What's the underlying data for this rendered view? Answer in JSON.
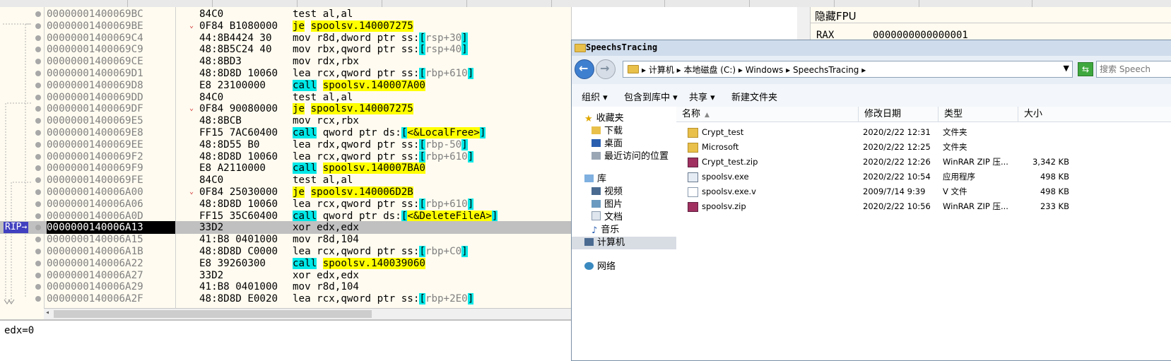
{
  "disassembly": {
    "rows": [
      {
        "addr": "00000001400069BC",
        "bytes": "84C0",
        "instr": [
          {
            "t": "test al,al"
          }
        ]
      },
      {
        "addr": "00000001400069BE",
        "bytes": "0F84 B1080000",
        "arrow": true,
        "instr": [
          {
            "t": "je",
            "h": "y"
          },
          {
            "t": " "
          },
          {
            "t": "spoolsv.140007275",
            "h": "y"
          }
        ]
      },
      {
        "addr": "00000001400069C4",
        "bytes": "44:8B4424 30",
        "instr": [
          {
            "t": "mov r8d,dword ptr ss:"
          },
          {
            "t": "[",
            "h": "c"
          },
          {
            "t": "rsp+30",
            "c": "dim"
          },
          {
            "t": "]",
            "h": "c"
          }
        ]
      },
      {
        "addr": "00000001400069C9",
        "bytes": "48:8B5C24 40",
        "instr": [
          {
            "t": "mov rbx,qword ptr ss:"
          },
          {
            "t": "[",
            "h": "c"
          },
          {
            "t": "rsp+40",
            "c": "dim"
          },
          {
            "t": "]",
            "h": "c"
          }
        ]
      },
      {
        "addr": "00000001400069CE",
        "bytes": "48:8BD3",
        "instr": [
          {
            "t": "mov rdx,rbx"
          }
        ]
      },
      {
        "addr": "00000001400069D1",
        "bytes": "48:8D8D 10060",
        "instr": [
          {
            "t": "lea rcx,qword ptr ss:"
          },
          {
            "t": "[",
            "h": "c"
          },
          {
            "t": "rbp+610",
            "c": "dim"
          },
          {
            "t": "]",
            "h": "c"
          }
        ]
      },
      {
        "addr": "00000001400069D8",
        "bytes": "E8 23100000",
        "instr": [
          {
            "t": "call",
            "h": "c"
          },
          {
            "t": " "
          },
          {
            "t": "spoolsv.140007A00",
            "h": "y"
          }
        ]
      },
      {
        "addr": "00000001400069DD",
        "bytes": "84C0",
        "instr": [
          {
            "t": "test al,al"
          }
        ]
      },
      {
        "addr": "00000001400069DF",
        "bytes": "0F84 90080000",
        "arrow": true,
        "instr": [
          {
            "t": "je",
            "h": "y"
          },
          {
            "t": " "
          },
          {
            "t": "spoolsv.140007275",
            "h": "y"
          }
        ]
      },
      {
        "addr": "00000001400069E5",
        "bytes": "48:8BCB",
        "instr": [
          {
            "t": "mov rcx,rbx"
          }
        ]
      },
      {
        "addr": "00000001400069E8",
        "bytes": "FF15 7AC60400",
        "instr": [
          {
            "t": "call",
            "h": "c"
          },
          {
            "t": " qword ptr ds:"
          },
          {
            "t": "[",
            "h": "c"
          },
          {
            "t": "<&LocalFree>",
            "h": "y"
          },
          {
            "t": "]",
            "h": "c"
          }
        ]
      },
      {
        "addr": "00000001400069EE",
        "bytes": "48:8D55 B0",
        "instr": [
          {
            "t": "lea rdx,qword ptr ss:"
          },
          {
            "t": "[",
            "h": "c"
          },
          {
            "t": "rbp-50",
            "c": "dim"
          },
          {
            "t": "]",
            "h": "c"
          }
        ]
      },
      {
        "addr": "00000001400069F2",
        "bytes": "48:8D8D 10060",
        "instr": [
          {
            "t": "lea rcx,qword ptr ss:"
          },
          {
            "t": "[",
            "h": "c"
          },
          {
            "t": "rbp+610",
            "c": "dim"
          },
          {
            "t": "]",
            "h": "c"
          }
        ]
      },
      {
        "addr": "00000001400069F9",
        "bytes": "E8 A2110000",
        "instr": [
          {
            "t": "call",
            "h": "c"
          },
          {
            "t": " "
          },
          {
            "t": "spoolsv.140007BA0",
            "h": "y"
          }
        ]
      },
      {
        "addr": "00000001400069FE",
        "bytes": "84C0",
        "instr": [
          {
            "t": "test al,al"
          }
        ]
      },
      {
        "addr": "0000000140006A00",
        "bytes": "0F84 25030000",
        "arrow": true,
        "instr": [
          {
            "t": "je",
            "h": "y"
          },
          {
            "t": " "
          },
          {
            "t": "spoolsv.140006D2B",
            "h": "y"
          }
        ]
      },
      {
        "addr": "0000000140006A06",
        "bytes": "48:8D8D 10060",
        "instr": [
          {
            "t": "lea rcx,qword ptr ss:"
          },
          {
            "t": "[",
            "h": "c"
          },
          {
            "t": "rbp+610",
            "c": "dim"
          },
          {
            "t": "]",
            "h": "c"
          }
        ]
      },
      {
        "addr": "0000000140006A0D",
        "bytes": "FF15 35C60400",
        "instr": [
          {
            "t": "call",
            "h": "c"
          },
          {
            "t": " qword ptr ds:"
          },
          {
            "t": "[",
            "h": "c"
          },
          {
            "t": "<&DeleteFileA>",
            "h": "y"
          },
          {
            "t": "]",
            "h": "c"
          }
        ]
      },
      {
        "addr": "0000000140006A13",
        "bytes": "33D2",
        "rip": true,
        "instr": [
          {
            "t": "xor edx,edx"
          }
        ]
      },
      {
        "addr": "0000000140006A15",
        "bytes": "41:B8 0401000",
        "instr": [
          {
            "t": "mov r8d,104"
          }
        ]
      },
      {
        "addr": "0000000140006A1B",
        "bytes": "48:8D8D C0000",
        "instr": [
          {
            "t": "lea rcx,qword ptr ss:"
          },
          {
            "t": "[",
            "h": "c"
          },
          {
            "t": "rbp+C0",
            "c": "dim"
          },
          {
            "t": "]",
            "h": "c"
          }
        ]
      },
      {
        "addr": "0000000140006A22",
        "bytes": "E8 39260300",
        "instr": [
          {
            "t": "call",
            "h": "c"
          },
          {
            "t": " "
          },
          {
            "t": "spoolsv.140039060",
            "h": "y"
          }
        ]
      },
      {
        "addr": "0000000140006A27",
        "bytes": "33D2",
        "instr": [
          {
            "t": "xor edx,edx"
          }
        ]
      },
      {
        "addr": "0000000140006A29",
        "bytes": "41:B8 0401000",
        "instr": [
          {
            "t": "mov r8d,104"
          }
        ]
      },
      {
        "addr": "0000000140006A2F",
        "bytes": "48:8D8D E0020",
        "instr": [
          {
            "t": "lea rcx,qword ptr ss:"
          },
          {
            "t": "[",
            "h": "c"
          },
          {
            "t": "rbp+2E0",
            "c": "dim"
          },
          {
            "t": "]",
            "h": "c"
          }
        ]
      }
    ],
    "rip_label": "RIP",
    "status_text": "edx=0"
  },
  "registers": {
    "header": "隐藏FPU",
    "rax_name": "RAX",
    "rax_value": "0000000000000001"
  },
  "explorer": {
    "window_title": "SpeechsTracing",
    "address_path": "▸ 计算机 ▸ 本地磁盘 (C:) ▸ Windows ▸ SpeechsTracing ▸",
    "search_placeholder": "搜索 Speech",
    "toolbar": {
      "organize": "组织 ▾",
      "include_library": "包含到库中 ▾",
      "share": "共享 ▾",
      "new_folder": "新建文件夹"
    },
    "nav": {
      "favorites": "收藏夹",
      "downloads": "下载",
      "desktop": "桌面",
      "recent": "最近访问的位置",
      "libraries": "库",
      "videos": "视频",
      "pictures": "图片",
      "documents": "文档",
      "music": "音乐",
      "computer": "计算机",
      "network": "网络"
    },
    "columns": {
      "name": "名称",
      "date": "修改日期",
      "type": "类型",
      "size": "大小"
    },
    "files": [
      {
        "name": "Crypt_test",
        "date": "2020/2/22 12:31",
        "type": "文件夹",
        "size": "",
        "icon": "folder"
      },
      {
        "name": "Microsoft",
        "date": "2020/2/22 12:25",
        "type": "文件夹",
        "size": "",
        "icon": "folder"
      },
      {
        "name": "Crypt_test.zip",
        "date": "2020/2/22 12:26",
        "type": "WinRAR ZIP 压...",
        "size": "3,342 KB",
        "icon": "zip"
      },
      {
        "name": "spoolsv.exe",
        "date": "2020/2/22 10:54",
        "type": "应用程序",
        "size": "498 KB",
        "icon": "exe"
      },
      {
        "name": "spoolsv.exe.v",
        "date": "2009/7/14 9:39",
        "type": "V 文件",
        "size": "498 KB",
        "icon": "file"
      },
      {
        "name": "spoolsv.zip",
        "date": "2020/2/22 10:56",
        "type": "WinRAR ZIP 压...",
        "size": "233 KB",
        "icon": "zip"
      }
    ]
  },
  "colors": {
    "highlight_yellow": "#ffff00",
    "highlight_cyan": "#00e8e8",
    "rip_row": "#c0c0c0",
    "explorer_title": "#cfdcec"
  }
}
